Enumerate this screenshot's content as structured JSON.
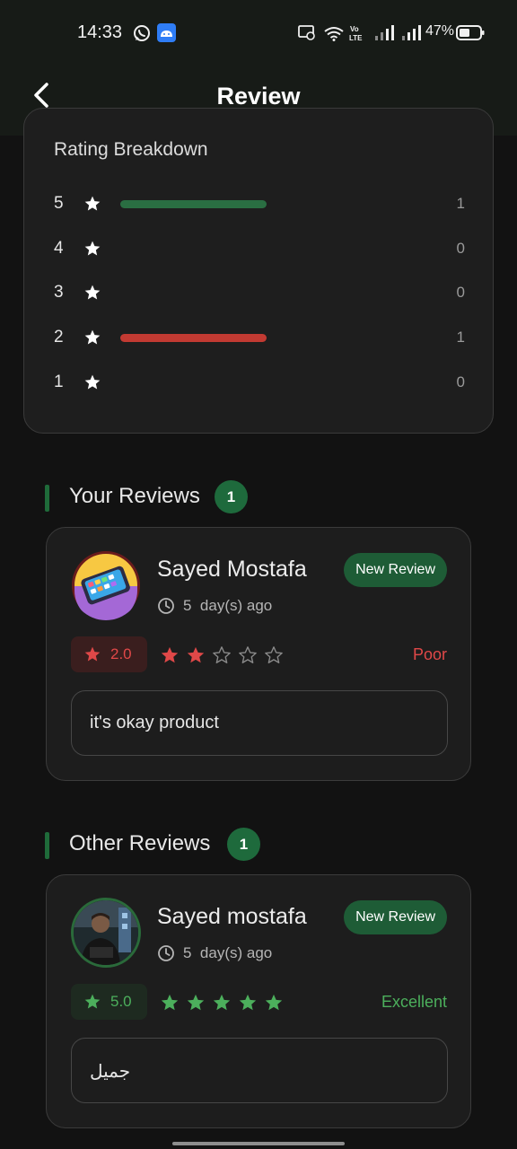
{
  "status_bar": {
    "time": "14:33",
    "battery_percent": "47%",
    "icons": [
      "whatsapp-icon",
      "android-icon",
      "cast-icon",
      "wifi-icon",
      "volte-icon",
      "signal-icon",
      "signal-icon",
      "battery-icon"
    ]
  },
  "header": {
    "title": "Review",
    "back_icon": "chevron-left-icon"
  },
  "breakdown": {
    "title": "Rating Breakdown",
    "rows": [
      {
        "stars": "5",
        "count": "1",
        "fill": 1.0,
        "color": "#2a6e42"
      },
      {
        "stars": "4",
        "count": "0",
        "fill": 0,
        "color": "#2a6e42"
      },
      {
        "stars": "3",
        "count": "0",
        "fill": 0,
        "color": "#2a6e42"
      },
      {
        "stars": "2",
        "count": "1",
        "fill": 1.0,
        "color": "#c23a32"
      },
      {
        "stars": "1",
        "count": "0",
        "fill": 0,
        "color": "#2a6e42"
      }
    ]
  },
  "your_reviews": {
    "title": "Your Reviews",
    "count": "1",
    "review": {
      "name": "Sayed Mostafa",
      "time_number": "5",
      "time_text": "day(s) ago",
      "badge": "New Review",
      "score": "2.0",
      "stars_filled": 2,
      "stars_total": 5,
      "rating_word": "Poor",
      "comment": "it's okay product",
      "accent_color": "#e04848",
      "avatar_icon": "phone-avatar-icon"
    }
  },
  "other_reviews": {
    "title": "Other Reviews",
    "count": "1",
    "review": {
      "name": "Sayed mostafa",
      "time_number": "5",
      "time_text": "day(s) ago",
      "badge": "New Review",
      "score": "5.0",
      "stars_filled": 5,
      "stars_total": 5,
      "rating_word": "Excellent",
      "comment": "جميل",
      "accent_color": "#4caf5c",
      "avatar_icon": "person-photo-avatar"
    }
  },
  "colors": {
    "background": "#121212",
    "card": "#1e1e1e",
    "green_accent": "#1e6a3c",
    "red": "#e04848",
    "green": "#4caf5c"
  }
}
